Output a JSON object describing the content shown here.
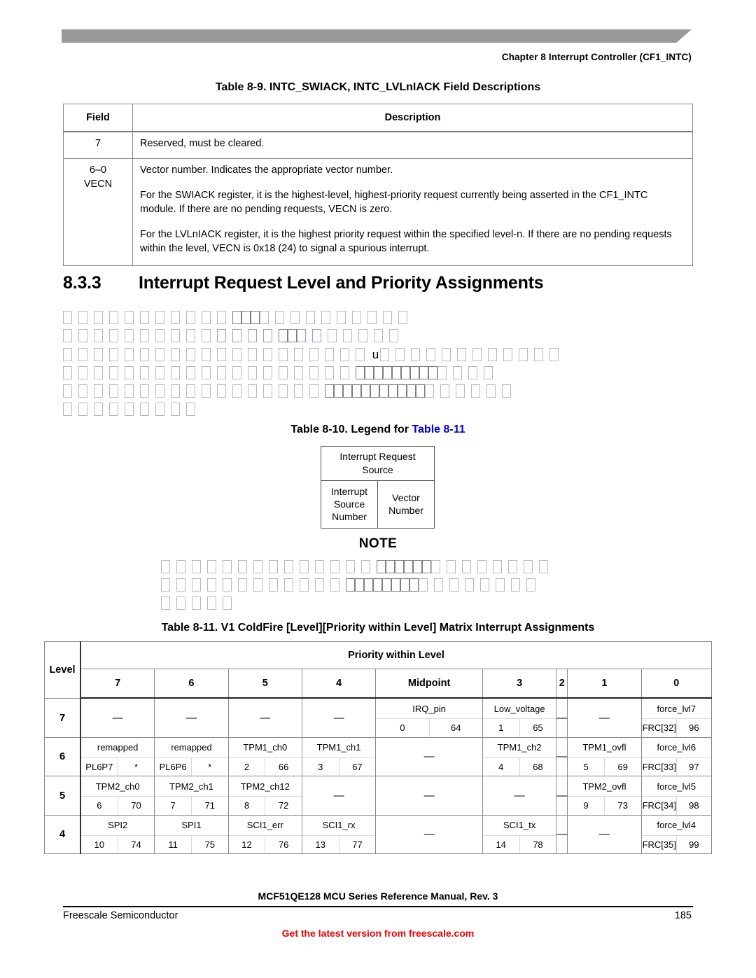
{
  "page": {
    "chapter_header": "Chapter 8 Interrupt Controller (CF1_INTC)",
    "footer_manual": "MCF51QE128 MCU Series Reference Manual, Rev. 3",
    "footer_company": "Freescale Semiconductor",
    "footer_page_number": "185",
    "footer_link": "Get the latest version from freescale.com",
    "link_color": "#ee0000",
    "header_bar_color": "#999999"
  },
  "table_8_9": {
    "title": "Table 8-9. INTC_SWIACK, INTC_LVLnIACK Field Descriptions",
    "columns": [
      "Field",
      "Description"
    ],
    "rows": [
      {
        "field": "7",
        "paragraphs": [
          "Reserved, must be cleared."
        ]
      },
      {
        "field": "6–0\nVECN",
        "paragraphs": [
          "Vector number. Indicates the appropriate vector number.",
          "For the SWIACK register, it is the highest-level, highest-priority request currently being asserted in the CF1_INTC module. If there are no pending requests, VECN is zero.",
          "For the LVLnIACK register, it is the highest priority request within the specified level-n. If there are no pending requests within the level, VECN is 0x18 (24) to signal a spurious interrupt."
        ]
      }
    ]
  },
  "section": {
    "number": "8.3.3",
    "title": "Interrupt Request Level and Priority Assignments"
  },
  "body_paragraphs": {
    "note": "Body text rendered as missing-glyph placeholder boxes (tofu) in the source screenshot.",
    "paragraph_1_lines": [
      {
        "boxes": 24,
        "groups": [
          {
            "at": 11,
            "count": 3
          }
        ],
        "link_from": null
      },
      {
        "boxes": 23,
        "groups": [
          {
            "at": 14,
            "count": 2
          }
        ],
        "link_from": 10,
        "link_to": 18
      }
    ],
    "paragraph_2_lines": [
      {
        "boxes": 33,
        "glyph_at": 20,
        "glyph": "u"
      },
      {
        "boxes": 32,
        "groups": [
          {
            "at": 19,
            "count": 9
          }
        ]
      },
      {
        "boxes": 34,
        "groups": [
          {
            "at": 17,
            "count": 11
          }
        ]
      },
      {
        "boxes": 9
      }
    ]
  },
  "table_8_10": {
    "title_prefix": "Table 8-10. Legend for ",
    "title_link": "Table 8-11",
    "source_label": "Interrupt Request\nSource",
    "source_number_label": "Interrupt\nSource\nNumber",
    "vector_number_label": "Vector\nNumber"
  },
  "note_block": {
    "title": "NOTE",
    "lines": [
      {
        "boxes": 28,
        "groups": [
          {
            "at": 14,
            "count": 6
          }
        ]
      },
      {
        "boxes": 28,
        "groups": [
          {
            "at": 12,
            "count": 8
          }
        ]
      },
      {
        "boxes": 5
      }
    ]
  },
  "table_8_11": {
    "title": "Table 8-11. V1 ColdFire [Level][Priority within Level] Matrix Interrupt Assignments",
    "level_header": "Level",
    "priority_header": "Priority within Level",
    "priority_columns": [
      "7",
      "6",
      "5",
      "4",
      "Midpoint",
      "3",
      "2",
      "1",
      "0"
    ],
    "dash": "—",
    "rows": [
      {
        "level": "7",
        "cells": [
          {
            "type": "dash"
          },
          {
            "type": "dash"
          },
          {
            "type": "dash"
          },
          {
            "type": "dash"
          },
          {
            "type": "entry",
            "source": "IRQ_pin",
            "source_number": "0",
            "vector_number": "64"
          },
          {
            "type": "entry",
            "source": "Low_voltage",
            "source_number": "1",
            "vector_number": "65"
          },
          {
            "type": "dash"
          },
          {
            "type": "dash"
          },
          {
            "type": "entry",
            "source": "force_lvl7",
            "source_number": "FRC[32]",
            "vector_number": "96"
          }
        ]
      },
      {
        "level": "6",
        "cells": [
          {
            "type": "entry",
            "source": "remapped",
            "source_number": "PL6P7",
            "vector_number": "*"
          },
          {
            "type": "entry",
            "source": "remapped",
            "source_number": "PL6P6",
            "vector_number": "*"
          },
          {
            "type": "entry",
            "source": "TPM1_ch0",
            "source_number": "2",
            "vector_number": "66"
          },
          {
            "type": "entry",
            "source": "TPM1_ch1",
            "source_number": "3",
            "vector_number": "67"
          },
          {
            "type": "dash"
          },
          {
            "type": "entry",
            "source": "TPM1_ch2",
            "source_number": "4",
            "vector_number": "68"
          },
          {
            "type": "dash"
          },
          {
            "type": "entry",
            "source": "TPM1_ovfl",
            "source_number": "5",
            "vector_number": "69"
          },
          {
            "type": "entry",
            "source": "force_lvl6",
            "source_number": "FRC[33]",
            "vector_number": "97"
          }
        ]
      },
      {
        "level": "5",
        "cells": [
          {
            "type": "entry",
            "source": "TPM2_ch0",
            "source_number": "6",
            "vector_number": "70"
          },
          {
            "type": "entry",
            "source": "TPM2_ch1",
            "source_number": "7",
            "vector_number": "71"
          },
          {
            "type": "entry",
            "source": "TPM2_ch12",
            "source_number": "8",
            "vector_number": "72"
          },
          {
            "type": "dash"
          },
          {
            "type": "dash"
          },
          {
            "type": "dash"
          },
          {
            "type": "dash"
          },
          {
            "type": "entry",
            "source": "TPM2_ovfl",
            "source_number": "9",
            "vector_number": "73"
          },
          {
            "type": "entry",
            "source": "force_lvl5",
            "source_number": "FRC[34]",
            "vector_number": "98"
          }
        ]
      },
      {
        "level": "4",
        "cells": [
          {
            "type": "entry",
            "source": "SPI2",
            "source_number": "10",
            "vector_number": "74"
          },
          {
            "type": "entry",
            "source": "SPI1",
            "source_number": "11",
            "vector_number": "75"
          },
          {
            "type": "entry",
            "source": "SCI1_err",
            "source_number": "12",
            "vector_number": "76"
          },
          {
            "type": "entry",
            "source": "SCI1_rx",
            "source_number": "13",
            "vector_number": "77"
          },
          {
            "type": "dash"
          },
          {
            "type": "entry",
            "source": "SCI1_tx",
            "source_number": "14",
            "vector_number": "78"
          },
          {
            "type": "dash"
          },
          {
            "type": "dash"
          },
          {
            "type": "entry",
            "source": "force_lvl4",
            "source_number": "FRC[35]",
            "vector_number": "99"
          }
        ]
      }
    ]
  }
}
